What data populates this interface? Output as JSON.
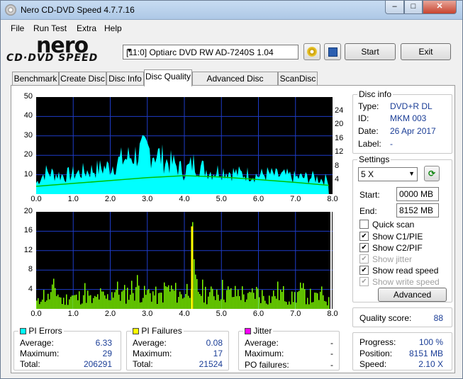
{
  "window": {
    "title": "Nero CD-DVD Speed 4.7.7.16",
    "min": "–",
    "max": "□",
    "close": "✕"
  },
  "menu": [
    "File",
    "Run Test",
    "Extra",
    "Help"
  ],
  "logo": {
    "line1": "nero",
    "line2": "CD·DVD SPEED"
  },
  "drive": {
    "selected": "[11:0]  Optiarc DVD RW AD-7240S 1.04"
  },
  "toolbar": {
    "start": "Start",
    "exit": "Exit"
  },
  "tabs": [
    "Benchmark",
    "Create Disc",
    "Disc Info",
    "Disc Quality",
    "Advanced Disc Quality",
    "ScanDisc"
  ],
  "active_tab": "Disc Quality",
  "chart_data": [
    {
      "type": "area",
      "title": "",
      "x_ticks": [
        "0.0",
        "1.0",
        "2.0",
        "3.0",
        "4.0",
        "5.0",
        "6.0",
        "7.0",
        "8.0"
      ],
      "y_left_ticks": [
        "10",
        "20",
        "30",
        "40",
        "50"
      ],
      "y_right_ticks": [
        "4",
        "8",
        "12",
        "16",
        "20",
        "24"
      ],
      "ylim": [
        0,
        50
      ],
      "xlim": [
        0,
        8
      ],
      "series": [
        {
          "name": "",
          "color": "#00ffff",
          "x": [
            0,
            0.25,
            0.5,
            0.75,
            1.0,
            1.25,
            1.5,
            1.75,
            2.0,
            2.25,
            2.5,
            2.75,
            3.0,
            3.25,
            3.5,
            3.75,
            4.0,
            4.25,
            4.5,
            4.75,
            5.0,
            5.25,
            5.5,
            5.75,
            6.0,
            6.25,
            6.5,
            6.75,
            7.0,
            7.25,
            7.5,
            7.75,
            7.9
          ],
          "y": [
            6,
            12,
            11,
            10,
            11,
            12,
            13,
            14,
            15,
            18,
            20,
            22,
            24,
            22,
            18,
            16,
            12,
            17,
            14,
            12,
            13,
            12,
            11,
            11,
            10,
            11,
            10,
            10,
            9,
            9,
            9,
            8,
            8
          ]
        },
        {
          "name": "",
          "color": "#00c000",
          "x": [
            0,
            1,
            2,
            3,
            4,
            5,
            6,
            7,
            7.9
          ],
          "y": [
            4.0,
            5.5,
            7.0,
            8.5,
            9.5,
            8.8,
            7.5,
            6.0,
            4.5
          ]
        }
      ]
    },
    {
      "type": "bar",
      "title": "",
      "x_ticks": [
        "0.0",
        "1.0",
        "2.0",
        "3.0",
        "4.0",
        "5.0",
        "6.0",
        "7.0",
        "8.0"
      ],
      "y_left_ticks": [
        "4",
        "8",
        "12",
        "16",
        "20"
      ],
      "ylim": [
        0,
        20
      ],
      "xlim": [
        0,
        8
      ],
      "series": [
        {
          "name": "",
          "color": "#80ff00",
          "x": [
            0.1,
            0.3,
            0.5,
            0.7,
            0.9,
            1.1,
            1.3,
            1.5,
            1.7,
            1.9,
            2.1,
            2.3,
            2.5,
            2.7,
            2.9,
            3.1,
            3.3,
            3.5,
            3.7,
            3.9,
            4.1,
            4.15,
            4.2,
            4.25,
            4.3,
            4.5,
            4.7,
            4.9,
            5.1,
            5.3,
            5.5,
            5.7,
            5.9,
            6.1,
            6.3,
            6.5,
            6.7,
            6.9,
            7.1,
            7.3,
            7.5,
            7.7,
            7.9
          ],
          "y": [
            5,
            3,
            6,
            2,
            4,
            3,
            5,
            2,
            4,
            3,
            6,
            4,
            5,
            7,
            4,
            5,
            3,
            6,
            5,
            4,
            6,
            11,
            17,
            9,
            6,
            5,
            4,
            6,
            5,
            4,
            5,
            3,
            5,
            4,
            3,
            5,
            4,
            3,
            5,
            4,
            3,
            4,
            2
          ]
        }
      ]
    }
  ],
  "stats": {
    "pi_errors": {
      "label": "PI Errors",
      "color": "#00ffff",
      "average_label": "Average:",
      "average": "6.33",
      "maximum_label": "Maximum:",
      "maximum": "29",
      "total_label": "Total:",
      "total": "206291"
    },
    "pi_failures": {
      "label": "PI Failures",
      "color": "#ffff00",
      "average_label": "Average:",
      "average": "0.08",
      "maximum_label": "Maximum:",
      "maximum": "17",
      "total_label": "Total:",
      "total": "21524"
    },
    "jitter": {
      "label": "Jitter",
      "color": "#ff00ff",
      "average_label": "Average:",
      "average": "-",
      "maximum_label": "Maximum:",
      "maximum": "-",
      "po_label": "PO failures:",
      "po": "-"
    }
  },
  "disc_info": {
    "heading": "Disc info",
    "type_label": "Type:",
    "type": "DVD+R DL",
    "id_label": "ID:",
    "id": "MKM 003",
    "date_label": "Date:",
    "date": "26 Apr 2017",
    "label_label": "Label:",
    "label": "-"
  },
  "settings": {
    "heading": "Settings",
    "speed": "5 X",
    "start_label": "Start:",
    "start": "0000 MB",
    "end_label": "End:",
    "end": "8152 MB",
    "quick_scan": "Quick scan",
    "show_c1pie": "Show C1/PIE",
    "show_c2pif": "Show C2/PIF",
    "show_jitter": "Show jitter",
    "show_read": "Show read speed",
    "show_write": "Show write speed",
    "advanced": "Advanced"
  },
  "quality": {
    "label": "Quality score:",
    "value": "88"
  },
  "progress": {
    "progress_label": "Progress:",
    "progress": "100 %",
    "position_label": "Position:",
    "position": "8151 MB",
    "speed_label": "Speed:",
    "speed": "2.10 X"
  }
}
